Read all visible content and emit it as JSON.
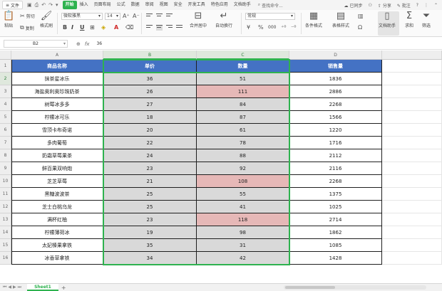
{
  "menubar": {
    "file": "文件",
    "tabs": [
      {
        "label": "开始",
        "active": true
      },
      {
        "label": "插入"
      },
      {
        "label": "页面布局"
      },
      {
        "label": "公式"
      },
      {
        "label": "数据"
      },
      {
        "label": "审阅"
      },
      {
        "label": "视图"
      },
      {
        "label": "安全"
      },
      {
        "label": "开发工具"
      },
      {
        "label": "特色应用"
      },
      {
        "label": "文档助手"
      }
    ],
    "search": "查找命令...",
    "sync": "已同步",
    "share": "分享",
    "comment": "批注"
  },
  "ribbon": {
    "paste": "粘贴",
    "cut": "剪切",
    "copy": "复制",
    "format_painter": "格式刷",
    "font_name": "微软雅黑",
    "font_size": "14",
    "bold": "B",
    "italic": "I",
    "underline": "U",
    "merge_center": "合并居中",
    "wrap_text": "自动换行",
    "number_format": "常规",
    "percent": "%",
    "thousands": "000",
    "cond_format": "条件格式",
    "table_style": "表格样式",
    "doc_assist": "文档助手",
    "sum": "求和",
    "filter": "筛选",
    "sort": "排序"
  },
  "formula_bar": {
    "name_box": "B2",
    "value": "36"
  },
  "columns": [
    "A",
    "B",
    "C",
    "D"
  ],
  "selected_columns": [
    "B",
    "C"
  ],
  "header_row": {
    "row_number": "1",
    "cells": [
      "商品名称",
      "单价",
      "数量",
      "销售量"
    ]
  },
  "rows": [
    {
      "n": "2",
      "name": "抹茶星冰乐",
      "price": "36",
      "qty": "51",
      "sales": "1836",
      "qty_highlight": false
    },
    {
      "n": "3",
      "name": "海盐奥利奥珍珠奶茶",
      "price": "26",
      "qty": "111",
      "sales": "2886",
      "qty_highlight": true
    },
    {
      "n": "4",
      "name": "树莓冰多多",
      "price": "27",
      "qty": "84",
      "sales": "2268",
      "qty_highlight": false
    },
    {
      "n": "5",
      "name": "柠檬冰可乐",
      "price": "18",
      "qty": "87",
      "sales": "1566",
      "qty_highlight": false
    },
    {
      "n": "6",
      "name": "雪顶卡布奇诺",
      "price": "20",
      "qty": "61",
      "sales": "1220",
      "qty_highlight": false
    },
    {
      "n": "7",
      "name": "多肉葡萄",
      "price": "22",
      "qty": "78",
      "sales": "1716",
      "qty_highlight": false
    },
    {
      "n": "8",
      "name": "奶霜草莓果茶",
      "price": "24",
      "qty": "88",
      "sales": "2112",
      "qty_highlight": false
    },
    {
      "n": "9",
      "name": "鲜百果双响炮",
      "price": "23",
      "qty": "92",
      "sales": "2116",
      "qty_highlight": false
    },
    {
      "n": "10",
      "name": "芝芝草莓",
      "price": "21",
      "qty": "108",
      "sales": "2268",
      "qty_highlight": true
    },
    {
      "n": "11",
      "name": "黑糖波波茶",
      "price": "25",
      "qty": "55",
      "sales": "1375",
      "qty_highlight": false
    },
    {
      "n": "12",
      "name": "芝士白桃乌龙",
      "price": "25",
      "qty": "41",
      "sales": "1025",
      "qty_highlight": false
    },
    {
      "n": "13",
      "name": "满杯红柚",
      "price": "23",
      "qty": "118",
      "sales": "2714",
      "qty_highlight": true
    },
    {
      "n": "14",
      "name": "柠檬薄荷冰",
      "price": "19",
      "qty": "98",
      "sales": "1862",
      "qty_highlight": false
    },
    {
      "n": "15",
      "name": "太妃榛果拿铁",
      "price": "35",
      "qty": "31",
      "sales": "1085",
      "qty_highlight": false
    },
    {
      "n": "16",
      "name": "冰香草拿铁",
      "price": "34",
      "qty": "42",
      "sales": "1428",
      "qty_highlight": false
    }
  ],
  "sheets": [
    {
      "label": "Sheet1",
      "active": true
    }
  ],
  "colors": {
    "header_fill": "#4472c4",
    "grey_fill": "#d9d9d9",
    "highlight_fill": "#e6b8b7",
    "selection": "#2eb24f"
  }
}
